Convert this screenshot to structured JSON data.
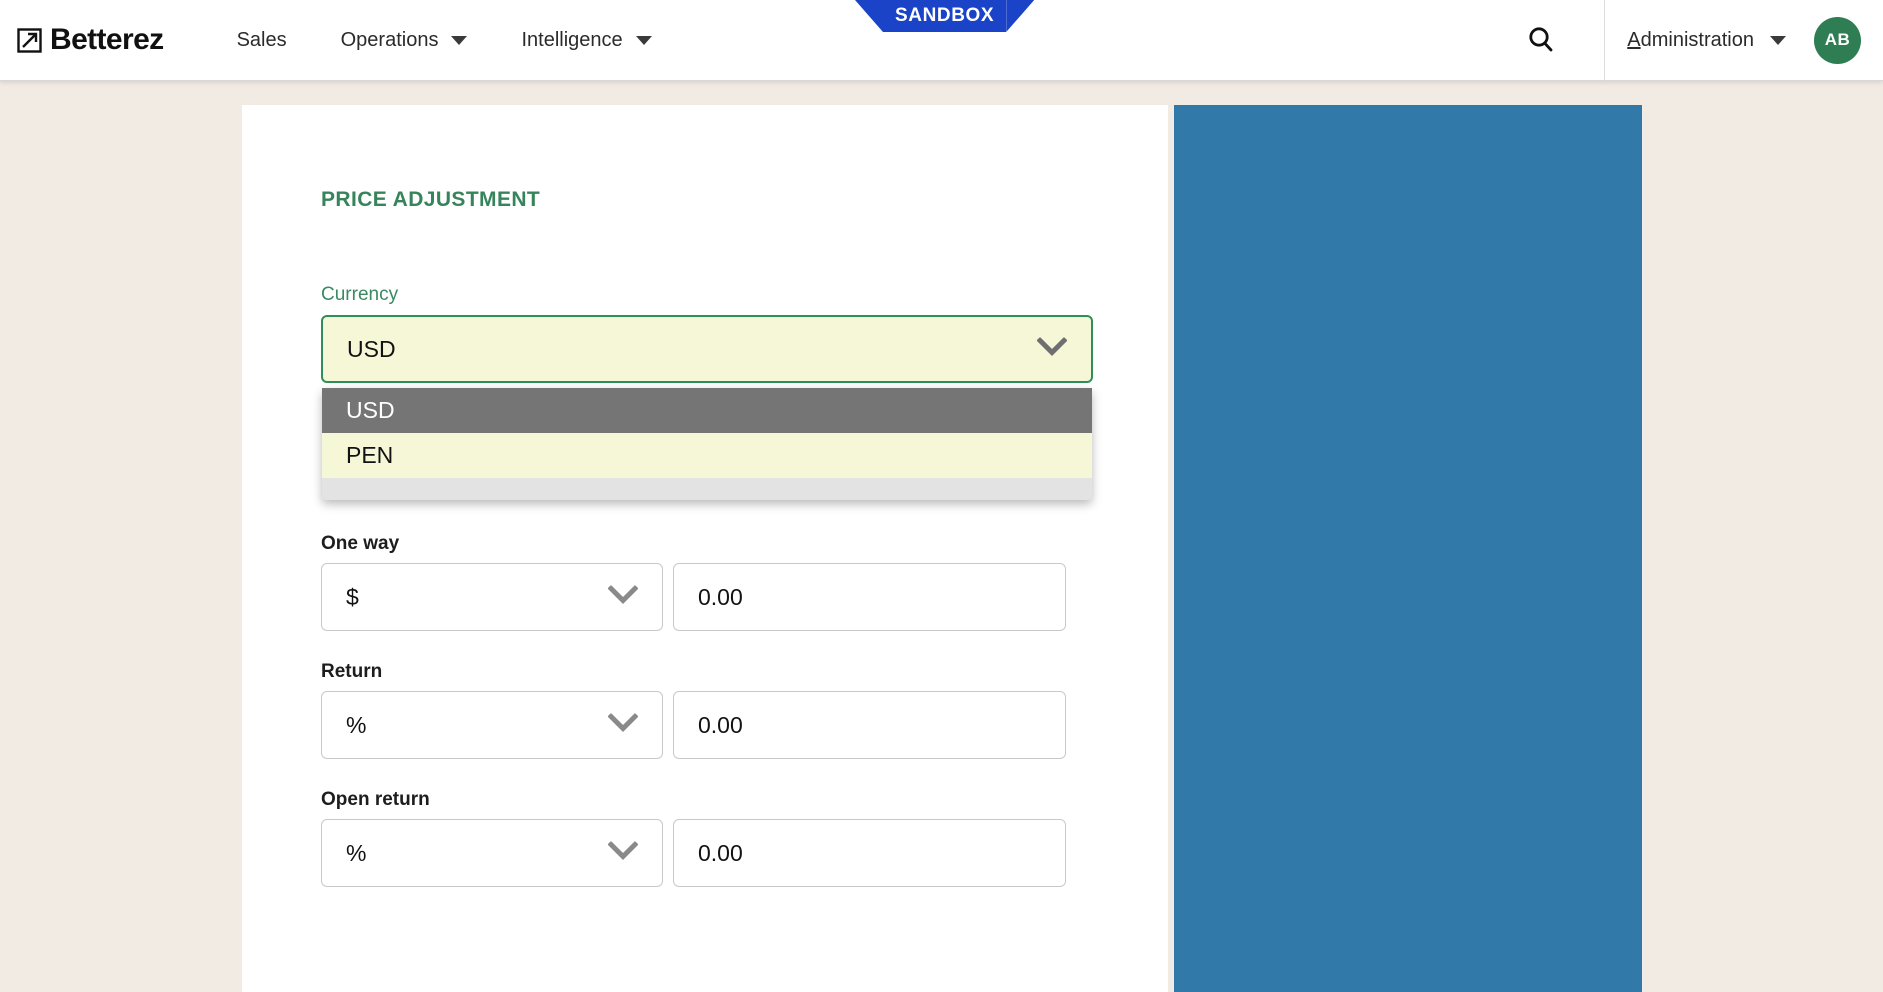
{
  "brand": {
    "name": "Betterez",
    "logo_icon": "arrow-square-logo-icon"
  },
  "env_badge": {
    "label": "SANDBOX",
    "color": "#1a43c8"
  },
  "nav": {
    "items": [
      {
        "label": "Sales",
        "has_caret": false
      },
      {
        "label": "Operations",
        "has_caret": true
      },
      {
        "label": "Intelligence",
        "has_caret": true
      }
    ]
  },
  "topbar_right": {
    "search_icon": "search-icon",
    "admin_label_accesskey": "A",
    "admin_label_rest": "dministration",
    "admin_caret_icon": "chevron-down-icon",
    "avatar_initials": "AB",
    "avatar_color": "#2f7d52"
  },
  "form": {
    "section_title": "PRICE ADJUSTMENT",
    "currency": {
      "label": "Currency",
      "value": "USD",
      "chevron_icon": "chevron-down-icon",
      "open": true,
      "options": [
        {
          "label": "USD",
          "highlighted": true
        },
        {
          "label": "PEN",
          "highlighted": false
        }
      ]
    },
    "rows": [
      {
        "label": "One way",
        "unit": "$",
        "amount": "0.00",
        "chevron_icon": "chevron-down-icon"
      },
      {
        "label": "Return",
        "unit": "%",
        "amount": "0.00",
        "chevron_icon": "chevron-down-icon"
      },
      {
        "label": "Open return",
        "unit": "%",
        "amount": "0.00",
        "chevron_icon": "chevron-down-icon"
      }
    ]
  },
  "side_panel": {
    "color": "#3179a8"
  },
  "theme": {
    "accent_green": "#37845c",
    "page_background": "#f2ebe3"
  }
}
